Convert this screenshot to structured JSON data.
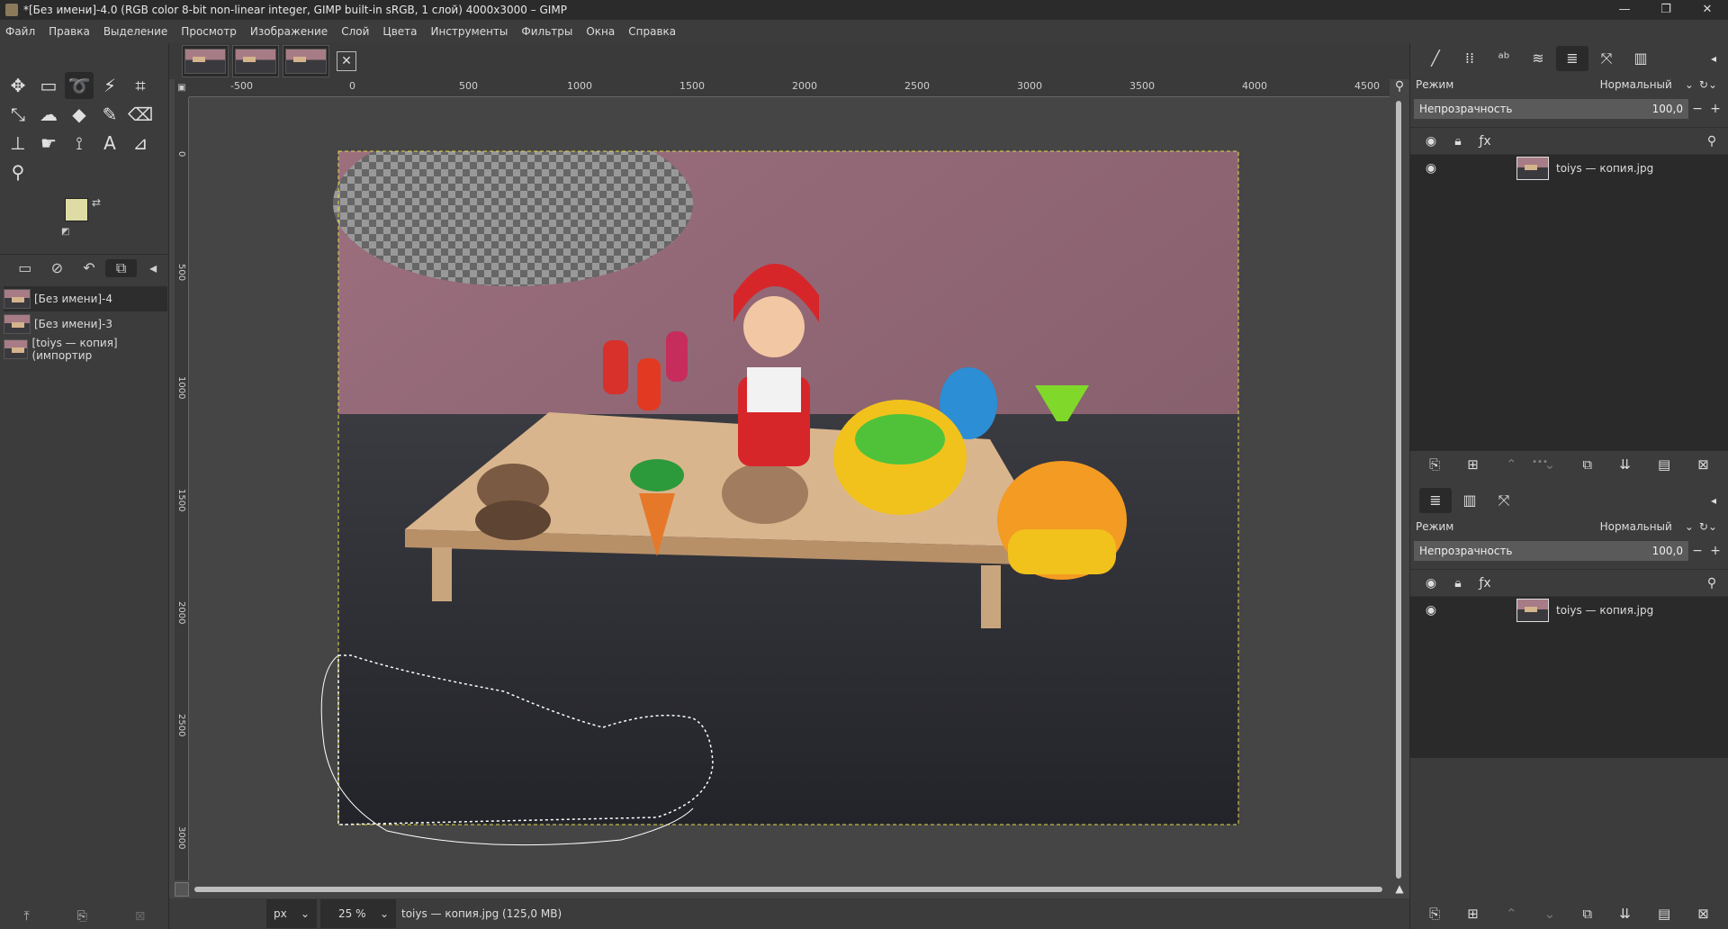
{
  "window": {
    "title": "*[Без имени]-4.0 (RGB color 8-bit non-linear integer, GIMP built-in sRGB, 1 слой) 4000x3000 – GIMP",
    "controls": [
      "—",
      "❐",
      "✕"
    ]
  },
  "menu": [
    "Файл",
    "Правка",
    "Выделение",
    "Просмотр",
    "Изображение",
    "Слой",
    "Цвета",
    "Инструменты",
    "Фильтры",
    "Окна",
    "Справка"
  ],
  "toolbox": {
    "tools": [
      "move-icon",
      "rect-select-icon",
      "lasso-icon",
      "fuzzy-select-icon",
      "crop-icon",
      "transform-icon",
      "warp-icon",
      "bucket-fill-icon",
      "paintbrush-icon",
      "eraser-icon",
      "clone-icon",
      "smudge-icon",
      "paths-icon",
      "text-icon",
      "color-picker-icon",
      "zoom-icon"
    ],
    "active_tool": "lasso-icon",
    "fg_color": "#dedca4",
    "bg_color": "#ffffff"
  },
  "images_panel": {
    "items": [
      {
        "label": "[Без имени]-4",
        "selected": true
      },
      {
        "label": "[Без имени]-3",
        "selected": false
      },
      {
        "label": "[toiys — копия] (импортир",
        "selected": false
      }
    ]
  },
  "ruler": {
    "h_labels": [
      "-500",
      "0",
      "500",
      "1000",
      "1500",
      "2000",
      "2500",
      "3000",
      "3500",
      "4000",
      "4500"
    ],
    "v_labels": [
      "0",
      "500",
      "1000",
      "1500",
      "2000",
      "2500",
      "3000"
    ]
  },
  "statusbar": {
    "unit": "px",
    "zoom": "25 %",
    "info": "toiys — копия.jpg (125,0 MB)"
  },
  "layers_top": {
    "mode_label": "Режим",
    "mode_value": "Нормальный",
    "opacity_label": "Непрозрачность",
    "opacity_value": "100,0",
    "layer_name": "toiys — копия.jpg"
  },
  "layers_bottom": {
    "mode_label": "Режим",
    "mode_value": "Нормальный",
    "opacity_label": "Непрозрачность",
    "opacity_value": "100,0",
    "layer_name": "toiys — копия.jpg"
  }
}
